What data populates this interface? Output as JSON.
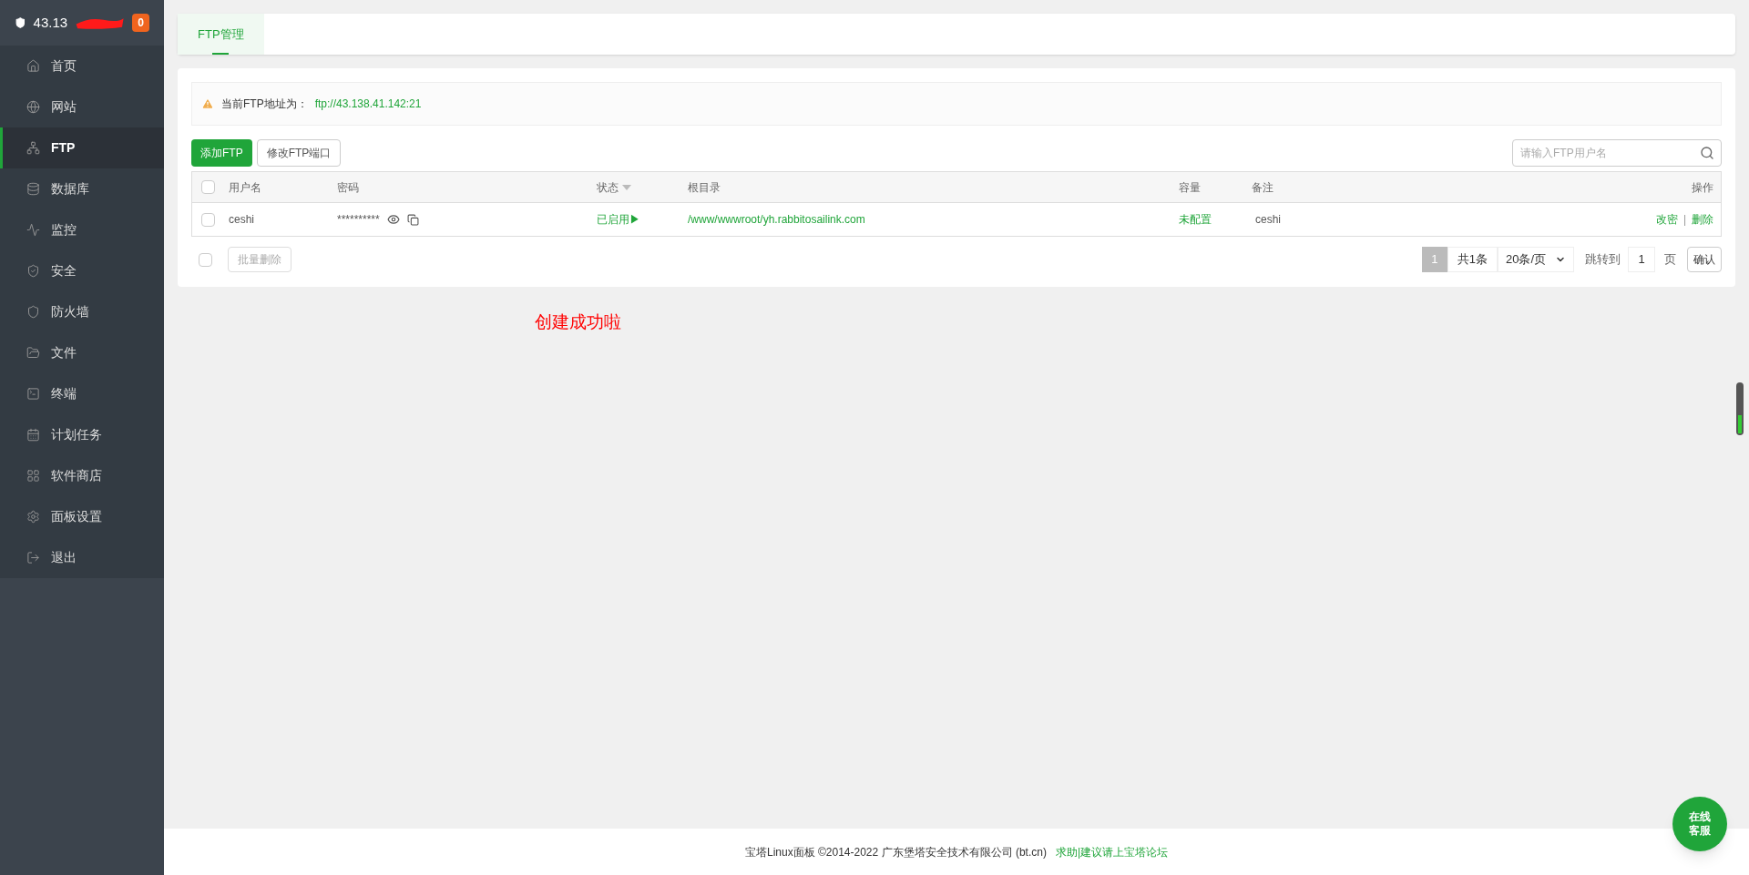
{
  "sidebar": {
    "server": "43.13",
    "badge": "0",
    "items": [
      {
        "label": "首页",
        "selected": false
      },
      {
        "label": "网站",
        "selected": false
      },
      {
        "label": "FTP",
        "selected": true
      },
      {
        "label": "数据库",
        "selected": false
      },
      {
        "label": "监控",
        "selected": false
      },
      {
        "label": "安全",
        "selected": false
      },
      {
        "label": "防火墙",
        "selected": false
      },
      {
        "label": "文件",
        "selected": false
      },
      {
        "label": "终端",
        "selected": false
      },
      {
        "label": "计划任务",
        "selected": false
      },
      {
        "label": "软件商店",
        "selected": false
      },
      {
        "label": "面板设置",
        "selected": false
      },
      {
        "label": "退出",
        "selected": false
      }
    ]
  },
  "tabs": [
    {
      "label": "FTP管理",
      "selected": true
    }
  ],
  "notice": {
    "label": "当前FTP地址为：",
    "address": "ftp://43.138.41.142:21"
  },
  "toolbar": {
    "buttons": [
      {
        "label": "添加FTP",
        "kind": "primary"
      },
      {
        "label": "修改FTP端口",
        "kind": "default"
      }
    ],
    "search": {
      "placeholder": "请输入FTP用户名"
    }
  },
  "table": {
    "header_checked": false,
    "columns": [
      "用户名",
      "密码",
      "状态",
      "根目录",
      "容量",
      "备注",
      "操作"
    ],
    "rows": [
      {
        "checked": false,
        "username": "ceshi",
        "password": "**********",
        "status": "已启用▶",
        "root": "/www/wwwroot/yh.rabbitosailink.com",
        "capacity": "未配置",
        "note": "ceshi",
        "actions": [
          "改密",
          "删除"
        ],
        "separator": "|"
      }
    ]
  },
  "bulk": {
    "checked": false,
    "button": "批量删除"
  },
  "pagination": {
    "pages": [
      {
        "label": "1",
        "selected": true
      }
    ],
    "total": "共1条",
    "page_size": "20条/页",
    "jump_label": "跳转到",
    "jump_value": "1",
    "page_unit": "页",
    "confirm": "确认"
  },
  "annotation": "创建成功啦",
  "footer": {
    "copyright": "宝塔Linux面板 ©2014-2022 广东堡塔安全技术有限公司 (bt.cn)",
    "link": "求助|建议请上宝塔论坛"
  },
  "chat_button": {
    "line1": "在线",
    "line2": "客服"
  }
}
